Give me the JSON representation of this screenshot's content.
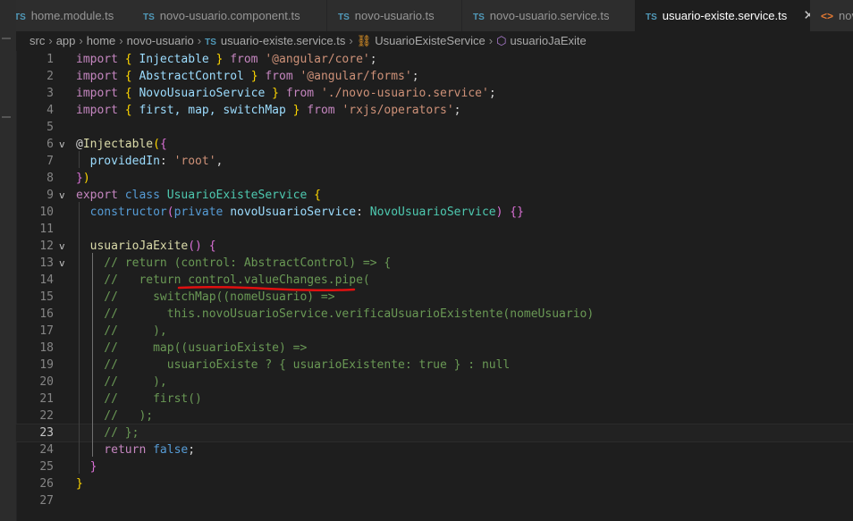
{
  "tabs": [
    {
      "name": "home.module.ts",
      "type": "ts"
    },
    {
      "name": "novo-usuario.component.ts",
      "type": "ts"
    },
    {
      "name": "novo-usuario.ts",
      "type": "ts"
    },
    {
      "name": "novo-usuario.service.ts",
      "type": "ts"
    },
    {
      "name": "usuario-existe.service.ts",
      "type": "ts",
      "active": true
    },
    {
      "name": "nov",
      "type": "html"
    }
  ],
  "icons": {
    "tab_type_ts": "TS",
    "tab_type_html": "<>",
    "close": "✕",
    "fold": "v",
    "class_icon": "⛓",
    "method_icon": "⬡"
  },
  "breadcrumb": [
    "src",
    "app",
    "home",
    "novo-usuario",
    "usuario-existe.service.ts",
    "UsuarioExisteService",
    "usuarioJaExite"
  ],
  "editor": {
    "current_line": 23,
    "line_numbers": [
      "1",
      "2",
      "3",
      "4",
      "5",
      "6",
      "7",
      "8",
      "9",
      "10",
      "11",
      "12",
      "13",
      "14",
      "15",
      "16",
      "17",
      "18",
      "19",
      "20",
      "21",
      "22",
      "23",
      "24",
      "25",
      "26",
      "27"
    ],
    "lines": [
      [
        [
          "import",
          "kc"
        ],
        [
          " ",
          "p"
        ],
        [
          "{",
          "b1"
        ],
        [
          " Injectable ",
          "v"
        ],
        [
          "}",
          "b1"
        ],
        [
          " from ",
          "kc"
        ],
        [
          "'@angular/core'",
          "s"
        ],
        [
          ";",
          "p"
        ]
      ],
      [
        [
          "import",
          "kc"
        ],
        [
          " ",
          "p"
        ],
        [
          "{",
          "b1"
        ],
        [
          " AbstractControl ",
          "v"
        ],
        [
          "}",
          "b1"
        ],
        [
          " from ",
          "kc"
        ],
        [
          "'@angular/forms'",
          "s"
        ],
        [
          ";",
          "p"
        ]
      ],
      [
        [
          "import",
          "kc"
        ],
        [
          " ",
          "p"
        ],
        [
          "{",
          "b1"
        ],
        [
          " NovoUsuarioService ",
          "v"
        ],
        [
          "}",
          "b1"
        ],
        [
          " from ",
          "kc"
        ],
        [
          "'./novo-usuario.service'",
          "s"
        ],
        [
          ";",
          "p"
        ]
      ],
      [
        [
          "import",
          "kc"
        ],
        [
          " ",
          "p"
        ],
        [
          "{",
          "b1"
        ],
        [
          " first, map, switchMap ",
          "v"
        ],
        [
          "}",
          "b1"
        ],
        [
          " from ",
          "kc"
        ],
        [
          "'rxjs/operators'",
          "s"
        ],
        [
          ";",
          "p"
        ]
      ],
      [],
      [
        [
          "@",
          "p"
        ],
        [
          "Injectable",
          "f"
        ],
        [
          "(",
          "b1"
        ],
        [
          "{",
          "b2"
        ]
      ],
      [
        [
          "  providedIn",
          "v"
        ],
        [
          ": ",
          "p"
        ],
        [
          "'root'",
          "s"
        ],
        [
          ",",
          "p"
        ]
      ],
      [
        [
          "}",
          "b2"
        ],
        [
          ")",
          "b1"
        ]
      ],
      [
        [
          "export",
          "kc"
        ],
        [
          " ",
          "p"
        ],
        [
          "class",
          "k"
        ],
        [
          " ",
          "p"
        ],
        [
          "UsuarioExisteService",
          "t"
        ],
        [
          " ",
          "p"
        ],
        [
          "{",
          "b1"
        ]
      ],
      [
        [
          "  constructor",
          "k"
        ],
        [
          "(",
          "b2"
        ],
        [
          "private",
          "k"
        ],
        [
          " novoUsuarioService",
          "v"
        ],
        [
          ": ",
          "p"
        ],
        [
          "NovoUsuarioService",
          "t"
        ],
        [
          ")",
          "b2"
        ],
        [
          " ",
          "p"
        ],
        [
          "{}",
          "b2"
        ]
      ],
      [],
      [
        [
          "  usuarioJaExite",
          "f"
        ],
        [
          "()",
          "b2"
        ],
        [
          " ",
          "p"
        ],
        [
          "{",
          "b2"
        ]
      ],
      [
        [
          "    // return (control: AbstractControl) => {",
          "c"
        ]
      ],
      [
        [
          "    //   return control.valueChanges.pipe(",
          "c"
        ]
      ],
      [
        [
          "    //     switchMap((nomeUsuario) =>",
          "c"
        ]
      ],
      [
        [
          "    //       this.novoUsuarioService.verificaUsuarioExistente(nomeUsuario)",
          "c"
        ]
      ],
      [
        [
          "    //     ),",
          "c"
        ]
      ],
      [
        [
          "    //     map((usuarioExiste) =>",
          "c"
        ]
      ],
      [
        [
          "    //       usuarioExiste ? { usuarioExistente: true } : null",
          "c"
        ]
      ],
      [
        [
          "    //     ),",
          "c"
        ]
      ],
      [
        [
          "    //     first()",
          "c"
        ]
      ],
      [
        [
          "    //   );",
          "c"
        ]
      ],
      [
        [
          "    // };",
          "c"
        ]
      ],
      [
        [
          "    return",
          "kc"
        ],
        [
          " ",
          "p"
        ],
        [
          "false",
          "k"
        ],
        [
          ";",
          "p"
        ]
      ],
      [
        [
          "  ",
          "p"
        ],
        [
          "}",
          "b2"
        ]
      ],
      [
        [
          "}",
          "b1"
        ]
      ],
      []
    ]
  }
}
